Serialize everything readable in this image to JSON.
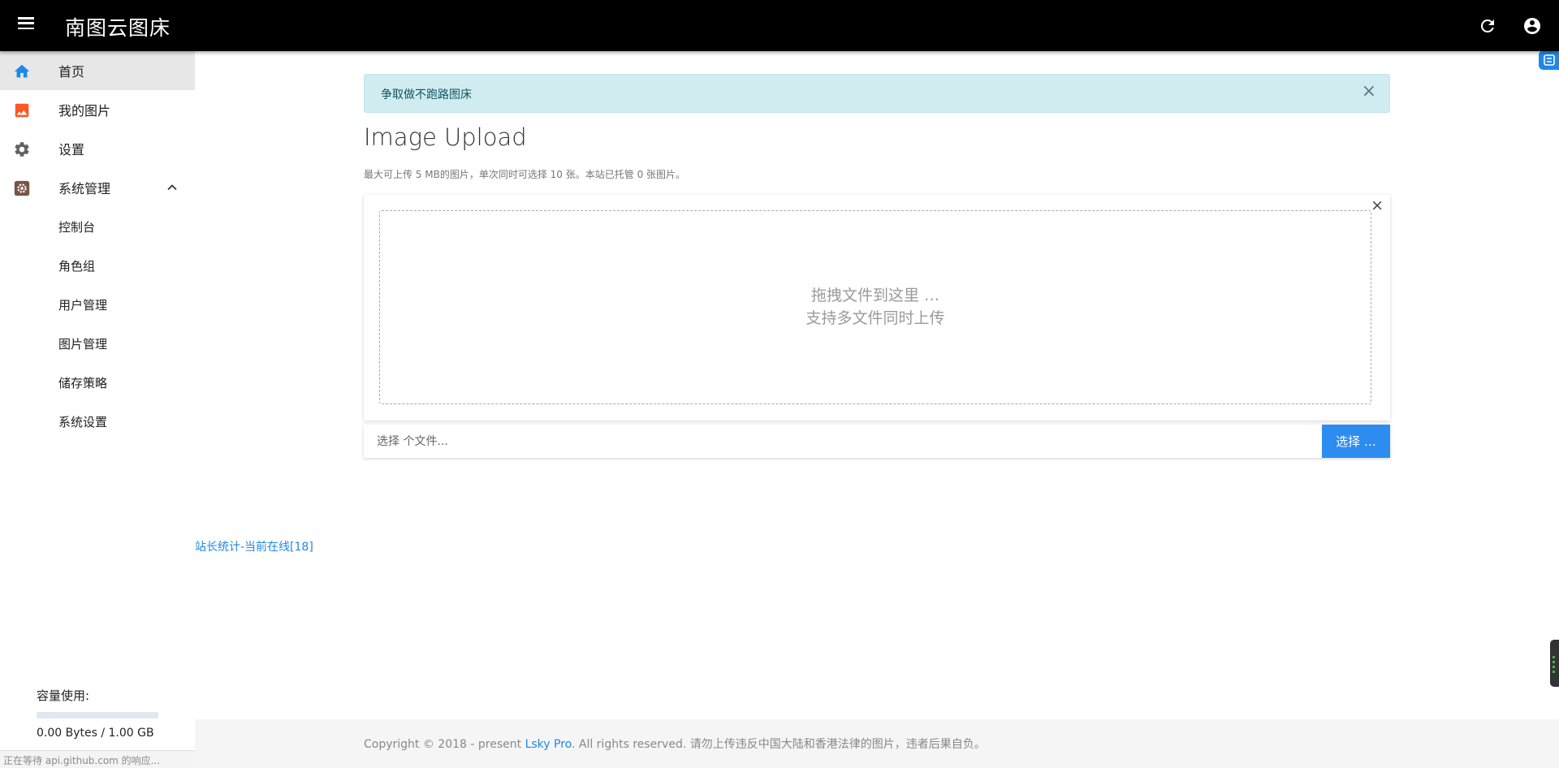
{
  "header": {
    "title": "南图云图床",
    "icons": {
      "menu": "menu-icon",
      "refresh": "refresh-icon",
      "account": "account-circle-icon"
    },
    "background": "#000000"
  },
  "sidebar": {
    "items": [
      {
        "label": "首页",
        "icon": "home-icon",
        "color": "#1e88e5",
        "active": true
      },
      {
        "label": "我的图片",
        "icon": "image-icon",
        "color": "#ff5722",
        "active": false
      },
      {
        "label": "设置",
        "icon": "gear-icon",
        "color": "#616161",
        "active": false
      },
      {
        "label": "系统管理",
        "icon": "admin-settings-icon",
        "color": "#795548",
        "active": false,
        "expanded": true
      }
    ],
    "sub_items": [
      {
        "label": "控制台"
      },
      {
        "label": "角色组"
      },
      {
        "label": "用户管理"
      },
      {
        "label": "图片管理"
      },
      {
        "label": "储存策略"
      },
      {
        "label": "系统设置"
      }
    ],
    "capacity": {
      "label": "容量使用:",
      "value": "0.00 Bytes / 1.00 GB",
      "fraction": 0
    }
  },
  "alert": {
    "text": "争取做不跑路图床",
    "close": "×"
  },
  "upload": {
    "title": "Image Upload",
    "description": "最大可上传 5 MB的图片，单次同时可选择 10 张。本站已托管 0 张图片。",
    "close": "×",
    "drop_line1": "拖拽文件到这里 …",
    "drop_line2": "支持多文件同时上传",
    "file_placeholder": "选择 个文件...",
    "choose_button": "选择 …"
  },
  "stats_link": "站长统计-当前在线[18]",
  "footer": {
    "prefix": "Copyright © 2018 - present ",
    "brand": "Lsky Pro",
    "suffix": ". All rights reserved. 请勿上传违反中国大陆和香港法律的图片，违者后果自负。"
  },
  "status_bar": "正在等待 api.github.com 的响应..."
}
